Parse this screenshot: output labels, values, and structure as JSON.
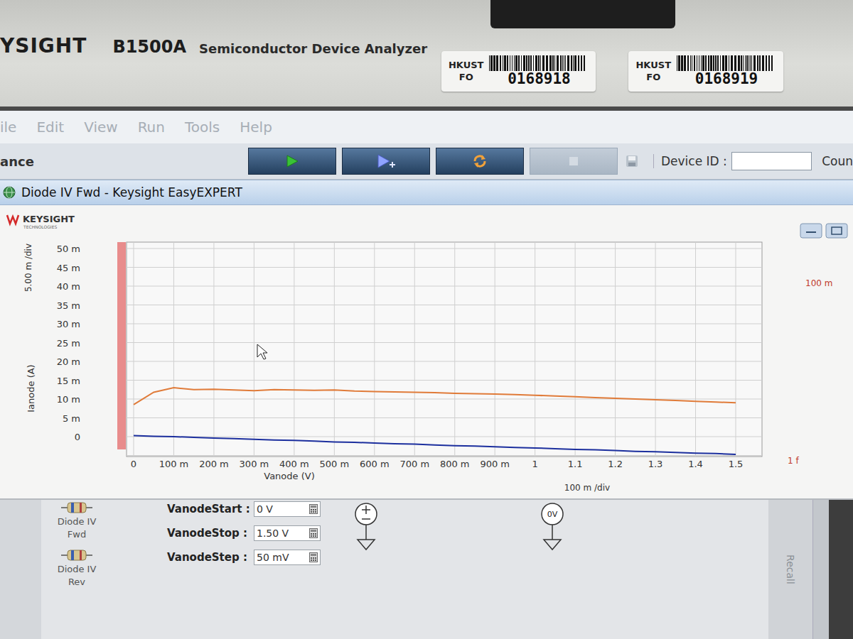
{
  "instrument": {
    "brand": "YSIGHT",
    "model": "B1500A",
    "description": "Semiconductor Device Analyzer",
    "asset_labels": [
      {
        "org": "HKUST",
        "dept": "FO",
        "number": "0168918"
      },
      {
        "org": "HKUST",
        "dept": "FO",
        "number": "0168919"
      }
    ]
  },
  "menu": [
    {
      "label": "ile",
      "disabled": true
    },
    {
      "label": "Edit",
      "disabled": true
    },
    {
      "label": "View",
      "disabled": true
    },
    {
      "label": "Run",
      "disabled": true
    },
    {
      "label": "Tools",
      "disabled": true
    },
    {
      "label": "Help",
      "disabled": true
    }
  ],
  "toolbar": {
    "label": "ance",
    "buttons": [
      {
        "kind": "run",
        "disabled": false
      },
      {
        "kind": "append",
        "disabled": false
      },
      {
        "kind": "repeat",
        "disabled": false
      },
      {
        "kind": "stop",
        "disabled": true
      },
      {
        "kind": "save",
        "disabled": true
      }
    ],
    "device_id": {
      "label": "Device ID :",
      "value": ""
    },
    "count_label": "Coun"
  },
  "window": {
    "title": "Diode IV Fwd - Keysight EasyEXPERT"
  },
  "chart": {
    "logo": {
      "name": "KEYSIGHT",
      "tagline": "TECHNOLOGIES"
    },
    "y_axis": {
      "label": "Ianode (A)",
      "scale": "5.00 m /div",
      "ticks": [
        "50 m",
        "45 m",
        "40 m",
        "35 m",
        "30 m",
        "25 m",
        "20 m",
        "15 m",
        "10 m",
        "5 m",
        "0"
      ]
    },
    "x_axis": {
      "label": "Vanode (V)",
      "scale": "100 m /div",
      "ticks": [
        "0",
        "100 m",
        "200 m",
        "300 m",
        "400 m",
        "500 m",
        "600 m",
        "700 m",
        "800 m",
        "900 m",
        "1",
        "1.1",
        "1.2",
        "1.3",
        "1.4",
        "1.5"
      ]
    },
    "right_axis": {
      "ticks": [
        "100 m",
        "1 f"
      ]
    },
    "x_values": [
      0,
      0.05,
      0.1,
      0.15,
      0.2,
      0.25,
      0.3,
      0.35,
      0.4,
      0.45,
      0.5,
      0.55,
      0.6,
      0.65,
      0.7,
      0.75,
      0.8,
      0.85,
      0.9,
      0.95,
      1.0,
      1.05,
      1.1,
      1.15,
      1.2,
      1.25,
      1.3,
      1.35,
      1.4,
      1.45,
      1.5
    ],
    "series": [
      {
        "color": "#e07b39",
        "values": [
          0.0085,
          0.0118,
          0.013,
          0.0125,
          0.0126,
          0.0124,
          0.0122,
          0.0125,
          0.0124,
          0.0123,
          0.0124,
          0.0121,
          0.012,
          0.0119,
          0.0118,
          0.0117,
          0.0115,
          0.0114,
          0.0113,
          0.0112,
          0.011,
          0.0108,
          0.0106,
          0.0104,
          0.0102,
          0.01,
          0.0098,
          0.0096,
          0.0094,
          0.0092,
          0.009
        ]
      },
      {
        "color": "#1c2f9e",
        "values": [
          0.0003,
          0.0001,
          0.0,
          -0.0002,
          -0.0004,
          -0.0005,
          -0.0007,
          -0.0009,
          -0.001,
          -0.0012,
          -0.0014,
          -0.0015,
          -0.0017,
          -0.0019,
          -0.002,
          -0.0022,
          -0.0024,
          -0.0025,
          -0.0027,
          -0.0029,
          -0.003,
          -0.0032,
          -0.0034,
          -0.0035,
          -0.0037,
          -0.0039,
          -0.004,
          -0.0042,
          -0.0044,
          -0.0045,
          -0.0047
        ]
      }
    ]
  },
  "setup": {
    "tests": [
      {
        "label": "Diode IV Fwd"
      },
      {
        "label": "Diode IV Rev"
      }
    ],
    "parameters": [
      {
        "name": "VanodeStart :",
        "value": "0 V"
      },
      {
        "name": "VanodeStop :",
        "value": "1.50 V"
      },
      {
        "name": "VanodeStep :",
        "value": "50 mV"
      }
    ],
    "source_label": "0V",
    "side_panel": "Recall"
  }
}
